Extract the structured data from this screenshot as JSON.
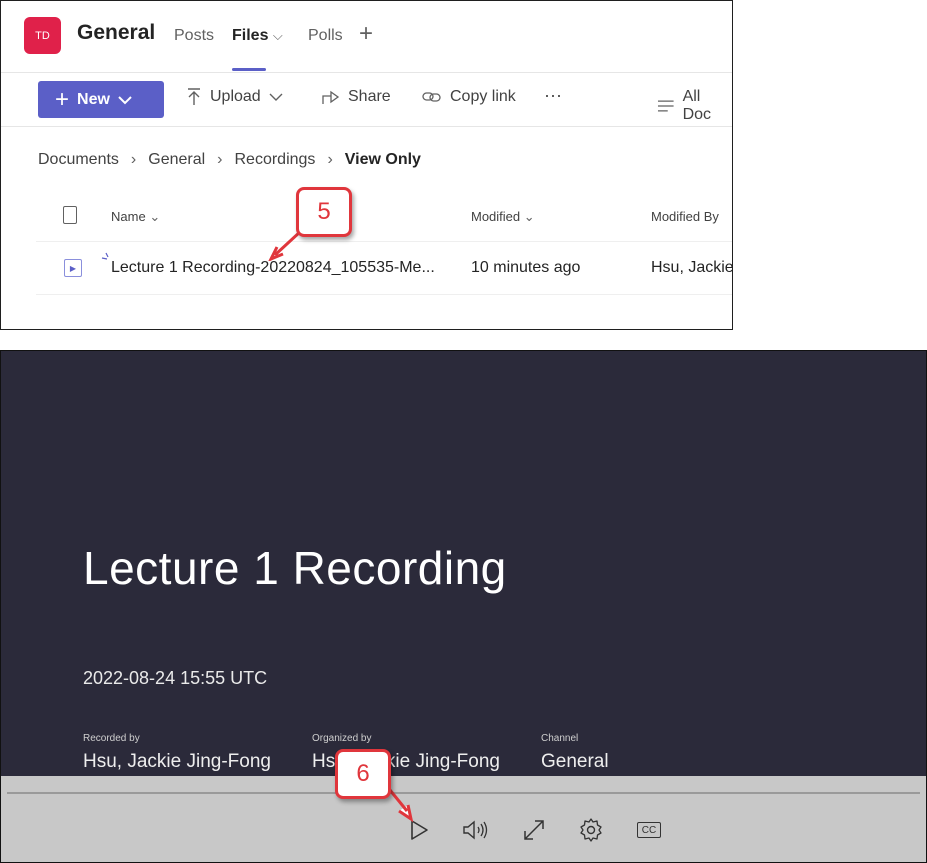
{
  "teams": {
    "avatar_initials": "TD",
    "channel": "General",
    "tabs": [
      {
        "label": "Posts"
      },
      {
        "label": "Files",
        "chevron": "⌵"
      },
      {
        "label": "Polls"
      }
    ],
    "add_tab_icon": "+",
    "toolbar": {
      "new_label": "New",
      "upload_label": "Upload",
      "share_label": "Share",
      "copy_link_label": "Copy link",
      "more_label": "···",
      "all_docs_label": "All Doc"
    },
    "breadcrumb": [
      "Documents",
      "General",
      "Recordings",
      "View Only"
    ],
    "columns": {
      "name": "Name",
      "modified": "Modified",
      "modified_by": "Modified By"
    },
    "file": {
      "name": "Lecture 1 Recording-20220824_105535-Me...",
      "modified": "10 minutes ago",
      "modified_by": "Hsu, Jackie"
    },
    "callout_step": "5"
  },
  "player": {
    "title": "Lecture 1 Recording",
    "datetime": "2022-08-24 15:55 UTC",
    "meta": [
      {
        "label": "Recorded by",
        "value": "Hsu, Jackie Jing-Fong"
      },
      {
        "label": "Organized by",
        "value": "Hsu, Jackie Jing-Fong"
      },
      {
        "label": "Channel",
        "value": "General"
      }
    ],
    "callout_step": "6"
  },
  "colors": {
    "accent": "#5b5fc7",
    "team_avatar": "#e0214a",
    "callout": "#e0363c",
    "player_bg": "#2b2a3a",
    "controls_bg": "#c8c8c8"
  }
}
